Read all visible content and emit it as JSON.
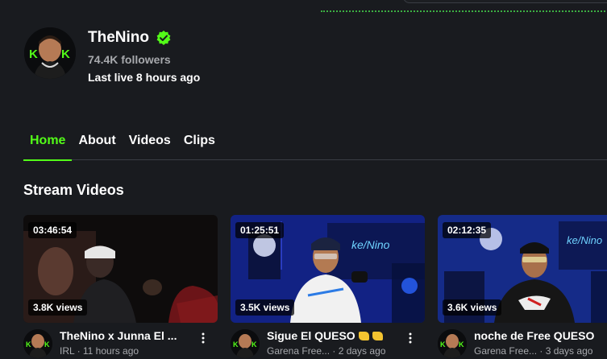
{
  "channel": {
    "name": "TheNino",
    "followers": "74.4K followers",
    "last_live": "Last live 8 hours ago"
  },
  "tabs": [
    {
      "label": "Home",
      "active": true
    },
    {
      "label": "About",
      "active": false
    },
    {
      "label": "Videos",
      "active": false
    },
    {
      "label": "Clips",
      "active": false
    }
  ],
  "section": {
    "title": "Stream Videos"
  },
  "videos": [
    {
      "duration": "03:46:54",
      "views": "3.8K views",
      "title": "TheNino x Junna El ...",
      "category": "IRL",
      "age": "11 hours ago",
      "meta": "IRL · 11 hours ago"
    },
    {
      "duration": "01:25:51",
      "views": "3.5K views",
      "title": "Sigue El QUESO",
      "title_emoji": "cheese-emoji",
      "category": "Garena Free...",
      "age": "2 days ago",
      "meta": "Garena Free... · 2 days ago"
    },
    {
      "duration": "02:12:35",
      "views": "3.6K views",
      "title": "noche de Free QUESO",
      "category": "Garena Free...",
      "age": "3 days ago",
      "meta": "Garena Free... · 3 days ago"
    }
  ],
  "colors": {
    "background": "#191b1f",
    "accent": "#53fc18",
    "muted_text": "#a7a9ad",
    "divider": "#3a3d44"
  },
  "icons": {
    "verified": "verified-badge-icon",
    "more": "more-vertical-icon"
  }
}
